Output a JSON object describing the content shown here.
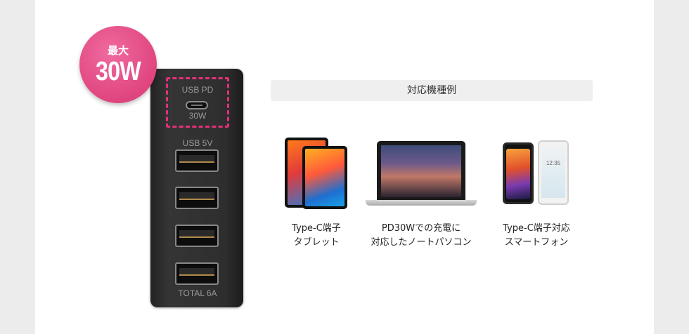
{
  "badge": {
    "label": "最大",
    "value": "30W"
  },
  "charger": {
    "pd_label": "USB PD",
    "pd_watt": "30W",
    "usb5v_label": "USB 5V",
    "total_label": "TOTAL 6A",
    "usb_a_port_count": 4
  },
  "compatible": {
    "title": "対応機種例",
    "devices": [
      {
        "line1": "Type-C端子",
        "line2": "タブレット",
        "icon": "tablet-icon"
      },
      {
        "line1": "PD30Wでの充電に",
        "line2": "対応したノートパソコン",
        "icon": "laptop-icon"
      },
      {
        "line1": "Type-C端子対応",
        "line2": "スマートフォン",
        "icon": "smartphone-icon"
      }
    ]
  },
  "colors": {
    "accent": "#e5307a",
    "badge": "#e0457f",
    "charger_body": "#2e2e2e",
    "header_bg": "#efefef"
  },
  "phone_screen_time": "12:35"
}
